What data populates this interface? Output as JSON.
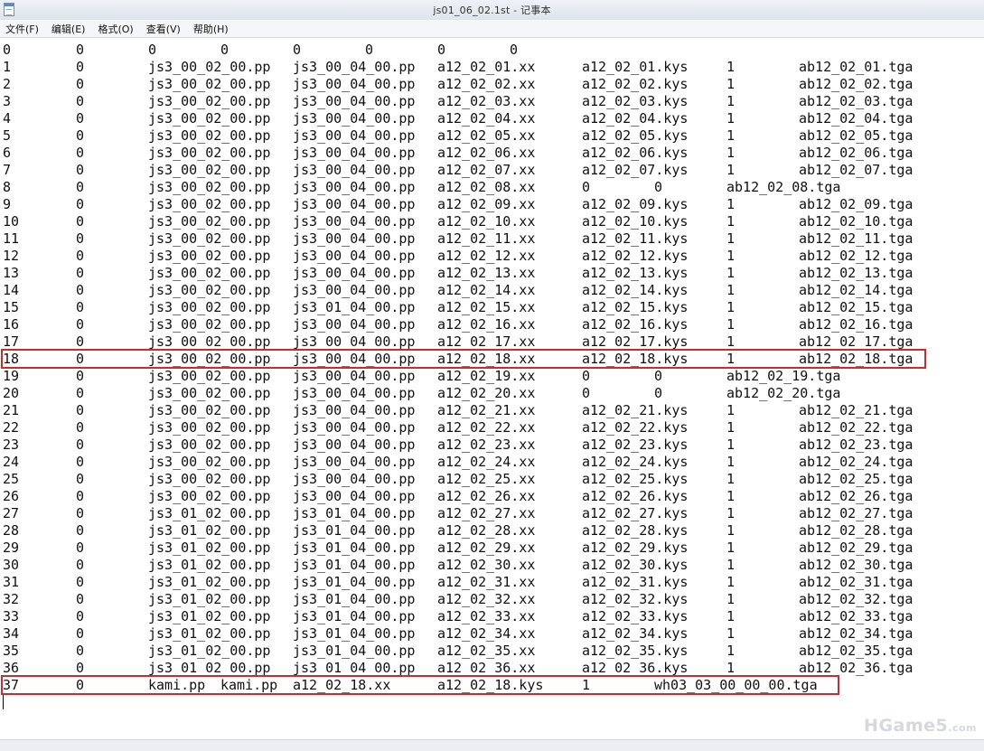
{
  "window": {
    "title": "js01_06_02.1st - 记事本"
  },
  "menu": {
    "items": [
      "文件(F)",
      "编辑(E)",
      "格式(O)",
      "查看(V)",
      "帮助(H)"
    ]
  },
  "rows": [
    [
      "0",
      "0",
      "0",
      "0",
      "0",
      "0",
      "0",
      "0"
    ],
    [
      "1",
      "0",
      "js3_00_02_00.pp",
      "js3_00_04_00.pp",
      "a12_02_01.xx",
      "a12_02_01.kys",
      "1",
      "ab12_02_01.tga"
    ],
    [
      "2",
      "0",
      "js3_00_02_00.pp",
      "js3_00_04_00.pp",
      "a12_02_02.xx",
      "a12_02_02.kys",
      "1",
      "ab12_02_02.tga"
    ],
    [
      "3",
      "0",
      "js3_00_02_00.pp",
      "js3_00_04_00.pp",
      "a12_02_03.xx",
      "a12_02_03.kys",
      "1",
      "ab12_02_03.tga"
    ],
    [
      "4",
      "0",
      "js3_00_02_00.pp",
      "js3_00_04_00.pp",
      "a12_02_04.xx",
      "a12_02_04.kys",
      "1",
      "ab12_02_04.tga"
    ],
    [
      "5",
      "0",
      "js3_00_02_00.pp",
      "js3_00_04_00.pp",
      "a12_02_05.xx",
      "a12_02_05.kys",
      "1",
      "ab12_02_05.tga"
    ],
    [
      "6",
      "0",
      "js3_00_02_00.pp",
      "js3_00_04_00.pp",
      "a12_02_06.xx",
      "a12_02_06.kys",
      "1",
      "ab12_02_06.tga"
    ],
    [
      "7",
      "0",
      "js3_00_02_00.pp",
      "js3_00_04_00.pp",
      "a12_02_07.xx",
      "a12_02_07.kys",
      "1",
      "ab12_02_07.tga"
    ],
    [
      "8",
      "0",
      "js3_00_02_00.pp",
      "js3_00_04_00.pp",
      "a12_02_08.xx",
      "0",
      "0",
      "ab12_02_08.tga"
    ],
    [
      "9",
      "0",
      "js3_00_02_00.pp",
      "js3_00_04_00.pp",
      "a12_02_09.xx",
      "a12_02_09.kys",
      "1",
      "ab12_02_09.tga"
    ],
    [
      "10",
      "0",
      "js3_00_02_00.pp",
      "js3_00_04_00.pp",
      "a12_02_10.xx",
      "a12_02_10.kys",
      "1",
      "ab12_02_10.tga"
    ],
    [
      "11",
      "0",
      "js3_00_02_00.pp",
      "js3_00_04_00.pp",
      "a12_02_11.xx",
      "a12_02_11.kys",
      "1",
      "ab12_02_11.tga"
    ],
    [
      "12",
      "0",
      "js3_00_02_00.pp",
      "js3_00_04_00.pp",
      "a12_02_12.xx",
      "a12_02_12.kys",
      "1",
      "ab12_02_12.tga"
    ],
    [
      "13",
      "0",
      "js3_00_02_00.pp",
      "js3_00_04_00.pp",
      "a12_02_13.xx",
      "a12_02_13.kys",
      "1",
      "ab12_02_13.tga"
    ],
    [
      "14",
      "0",
      "js3_00_02_00.pp",
      "js3_00_04_00.pp",
      "a12_02_14.xx",
      "a12_02_14.kys",
      "1",
      "ab12_02_14.tga"
    ],
    [
      "15",
      "0",
      "js3_00_02_00.pp",
      "js3_01_04_00.pp",
      "a12_02_15.xx",
      "a12_02_15.kys",
      "1",
      "ab12_02_15.tga"
    ],
    [
      "16",
      "0",
      "js3_00_02_00.pp",
      "js3_00_04_00.pp",
      "a12_02_16.xx",
      "a12_02_16.kys",
      "1",
      "ab12_02_16.tga"
    ],
    [
      "17",
      "0",
      "js3_00_02_00.pp",
      "js3_00_04_00.pp",
      "a12_02_17.xx",
      "a12_02_17.kys",
      "1",
      "ab12_02_17.tga"
    ],
    [
      "18",
      "0",
      "js3_00_02_00.pp",
      "js3_00_04_00.pp",
      "a12_02_18.xx",
      "a12_02_18.kys",
      "1",
      "ab12_02_18.tga"
    ],
    [
      "19",
      "0",
      "js3_00_02_00.pp",
      "js3_00_04_00.pp",
      "a12_02_19.xx",
      "0",
      "0",
      "ab12_02_19.tga"
    ],
    [
      "20",
      "0",
      "js3_00_02_00.pp",
      "js3_00_04_00.pp",
      "a12_02_20.xx",
      "0",
      "0",
      "ab12_02_20.tga"
    ],
    [
      "21",
      "0",
      "js3_00_02_00.pp",
      "js3_00_04_00.pp",
      "a12_02_21.xx",
      "a12_02_21.kys",
      "1",
      "ab12_02_21.tga"
    ],
    [
      "22",
      "0",
      "js3_00_02_00.pp",
      "js3_00_04_00.pp",
      "a12_02_22.xx",
      "a12_02_22.kys",
      "1",
      "ab12_02_22.tga"
    ],
    [
      "23",
      "0",
      "js3_00_02_00.pp",
      "js3_00_04_00.pp",
      "a12_02_23.xx",
      "a12_02_23.kys",
      "1",
      "ab12_02_23.tga"
    ],
    [
      "24",
      "0",
      "js3_00_02_00.pp",
      "js3_00_04_00.pp",
      "a12_02_24.xx",
      "a12_02_24.kys",
      "1",
      "ab12_02_24.tga"
    ],
    [
      "25",
      "0",
      "js3_00_02_00.pp",
      "js3_00_04_00.pp",
      "a12_02_25.xx",
      "a12_02_25.kys",
      "1",
      "ab12_02_25.tga"
    ],
    [
      "26",
      "0",
      "js3_00_02_00.pp",
      "js3_00_04_00.pp",
      "a12_02_26.xx",
      "a12_02_26.kys",
      "1",
      "ab12_02_26.tga"
    ],
    [
      "27",
      "0",
      "js3_01_02_00.pp",
      "js3_01_04_00.pp",
      "a12_02_27.xx",
      "a12_02_27.kys",
      "1",
      "ab12_02_27.tga"
    ],
    [
      "28",
      "0",
      "js3_01_02_00.pp",
      "js3_01_04_00.pp",
      "a12_02_28.xx",
      "a12_02_28.kys",
      "1",
      "ab12_02_28.tga"
    ],
    [
      "29",
      "0",
      "js3_01_02_00.pp",
      "js3_01_04_00.pp",
      "a12_02_29.xx",
      "a12_02_29.kys",
      "1",
      "ab12_02_29.tga"
    ],
    [
      "30",
      "0",
      "js3_01_02_00.pp",
      "js3_01_04_00.pp",
      "a12_02_30.xx",
      "a12_02_30.kys",
      "1",
      "ab12_02_30.tga"
    ],
    [
      "31",
      "0",
      "js3_01_02_00.pp",
      "js3_01_04_00.pp",
      "a12_02_31.xx",
      "a12_02_31.kys",
      "1",
      "ab12_02_31.tga"
    ],
    [
      "32",
      "0",
      "js3_01_02_00.pp",
      "js3_01_04_00.pp",
      "a12_02_32.xx",
      "a12_02_32.kys",
      "1",
      "ab12_02_32.tga"
    ],
    [
      "33",
      "0",
      "js3_01_02_00.pp",
      "js3_01_04_00.pp",
      "a12_02_33.xx",
      "a12_02_33.kys",
      "1",
      "ab12_02_33.tga"
    ],
    [
      "34",
      "0",
      "js3_01_02_00.pp",
      "js3_01_04_00.pp",
      "a12_02_34.xx",
      "a12_02_34.kys",
      "1",
      "ab12_02_34.tga"
    ],
    [
      "35",
      "0",
      "js3_01_02_00.pp",
      "js3_01_04_00.pp",
      "a12_02_35.xx",
      "a12_02_35.kys",
      "1",
      "ab12_02_35.tga"
    ],
    [
      "36",
      "0",
      "js3_01_02_00.pp",
      "js3_01_04_00.pp",
      "a12_02_36.xx",
      "a12_02_36.kys",
      "1",
      "ab12_02_36.tga"
    ],
    [
      "37",
      "0",
      "kami.pp",
      "kami.pp",
      "a12_02_18.xx",
      "a12_02_18.kys",
      "1",
      "wh03_03_00_00_00.tga"
    ]
  ],
  "highlighted_rows": [
    18,
    37
  ],
  "highlight_color": "#cc2b2b",
  "watermark": {
    "main": "HGame5",
    "suffix": ".com"
  }
}
